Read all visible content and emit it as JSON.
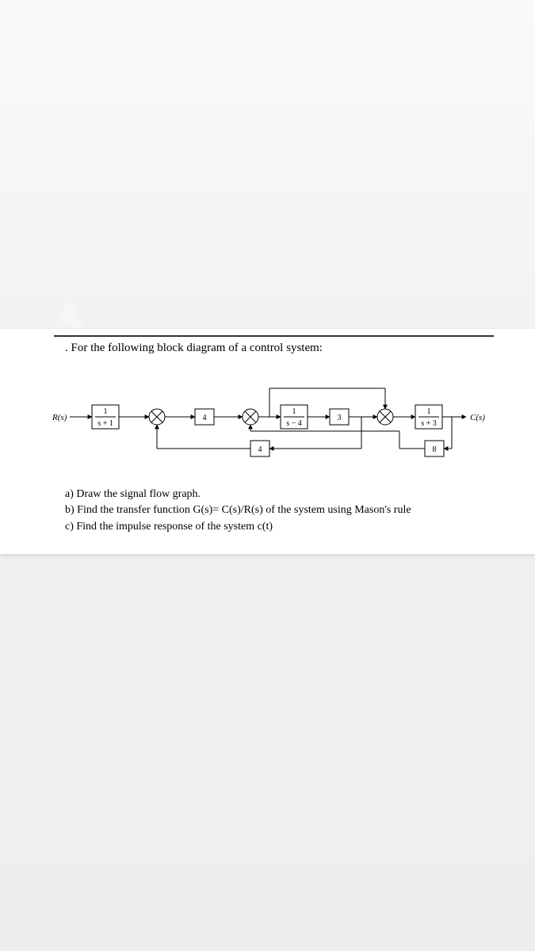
{
  "title": ". For the following block diagram of a control system:",
  "input_label": "R(s)",
  "output_label": "C(s)",
  "blocks": {
    "g1_num": "1",
    "g1_den": "s + 1",
    "g2": "4",
    "g3_num": "1",
    "g3_den": "s − 4",
    "g4": "3",
    "g5_num": "1",
    "g5_den": "s + 3",
    "h1": "4",
    "h2": "8"
  },
  "questions": {
    "a": "a)  Draw the signal flow graph.",
    "b": "b)  Find the transfer  function G(s)= C(s)/R(s) of the system using Mason's rule",
    "c": "c)  Find the impulse response of the system  c(t)"
  }
}
